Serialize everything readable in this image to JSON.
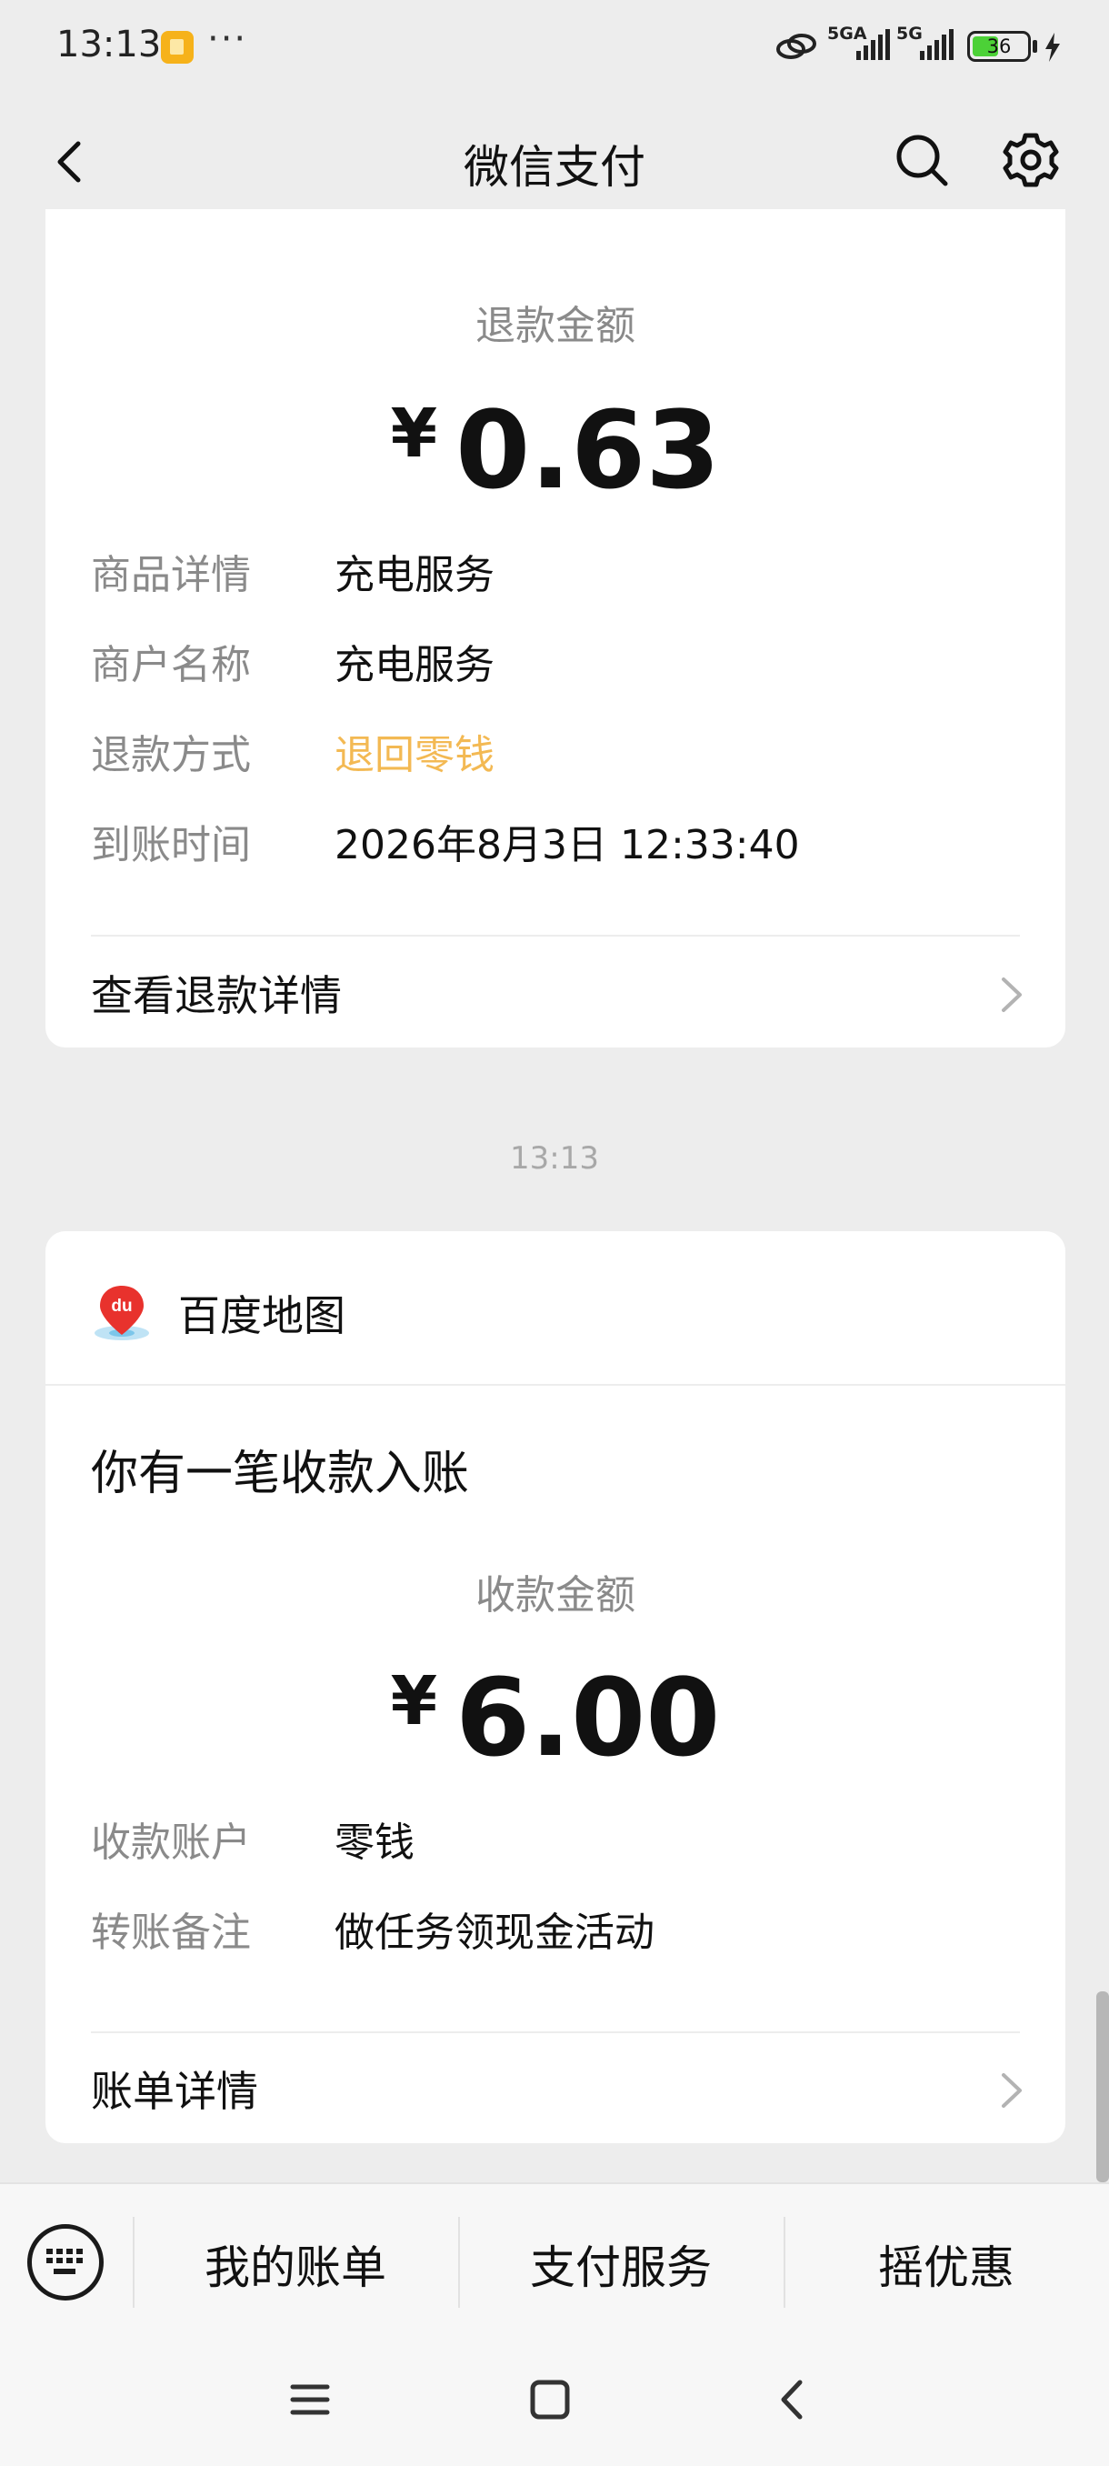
{
  "status_bar": {
    "time": "13:13",
    "more": "···",
    "signal1_label": "5GA",
    "signal2_label": "5G",
    "battery": "36"
  },
  "nav": {
    "title": "微信支付"
  },
  "refund_card": {
    "amount_label": "退款金额",
    "currency": "¥",
    "amount": "0.63",
    "rows": [
      {
        "key": "商品详情",
        "value": "充电服务"
      },
      {
        "key": "商户名称",
        "value": "充电服务"
      },
      {
        "key": "退款方式",
        "value": "退回零钱"
      },
      {
        "key": "到账时间",
        "value": "2026年8月3日 12:33:40"
      }
    ],
    "link": "查看退款详情"
  },
  "timestamp": "13:13",
  "receipt_card": {
    "merchant": "百度地图",
    "title": "你有一笔收款入账",
    "amount_label": "收款金额",
    "currency": "¥",
    "amount": "6.00",
    "rows": [
      {
        "key": "收款账户",
        "value": "零钱"
      },
      {
        "key": "转账备注",
        "value": "做任务领现金活动"
      }
    ],
    "link": "账单详情"
  },
  "bottom_menu": {
    "items": [
      "我的账单",
      "支付服务",
      "摇优惠"
    ]
  },
  "colors": {
    "background": "#ededed",
    "card": "#ffffff",
    "refund_method_accent": "#f3b953",
    "muted_text": "#8a8a8a"
  },
  "icons": [
    "back-icon",
    "search-icon",
    "settings-icon",
    "chevron-right-icon",
    "keyboard-icon",
    "baidu-map-logo",
    "menu-icon",
    "home-icon",
    "nav-back-icon"
  ]
}
